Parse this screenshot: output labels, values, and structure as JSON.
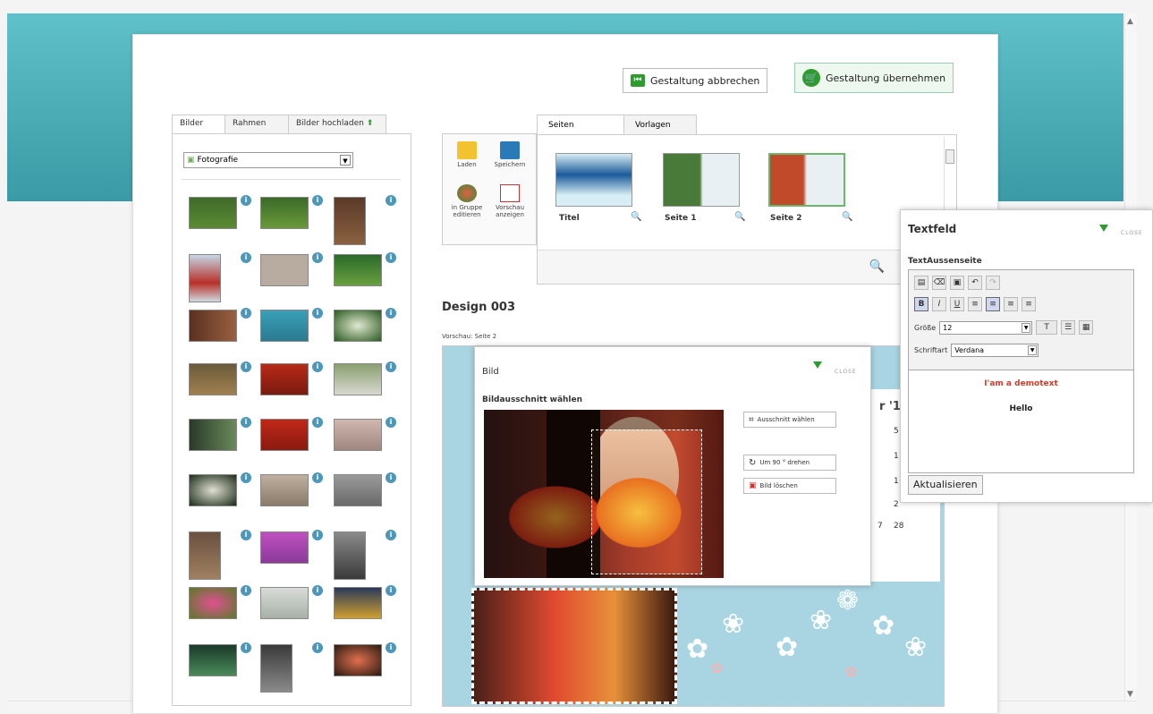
{
  "header": {
    "cancel_label": "Gestaltung abbrechen",
    "apply_label": "Gestaltung übernehmen"
  },
  "left_panel": {
    "tabs": [
      "Bilder",
      "Rahmen",
      "Bilder hochladen"
    ],
    "category_select": "Fotografie"
  },
  "toolbox": {
    "load": "Laden",
    "save": "Speichern",
    "group_edit": "in Gruppe editieren",
    "preview": "Vorschau anzeigen"
  },
  "pages": {
    "tabs": [
      "Seiten",
      "Vorlagen"
    ],
    "items": [
      "Titel",
      "Seite 1",
      "Seite 2"
    ]
  },
  "design": {
    "title": "Design 003",
    "preview_label": "Vorschau: Seite 2",
    "calendar_month_partial": "r '1",
    "calendar_numbers": [
      "5",
      "1",
      "1",
      "2",
      "28",
      "7"
    ]
  },
  "bild_dialog": {
    "title": "Bild",
    "close": "CLOSE",
    "subtitle": "Bildausschnitt wählen",
    "crop_btn": "Ausschnitt wählen",
    "rotate_btn": "Um 90 ° drehen",
    "delete_btn": "Bild löschen"
  },
  "textfeld_dialog": {
    "title": "Textfeld",
    "close": "CLOSE",
    "subtitle": "TextAussenseite",
    "size_label": "Größe",
    "size_value": "12",
    "font_label": "Schriftart",
    "font_value": "Verdana",
    "red_text": "I'am a demotext",
    "hello_text": "Hello",
    "update_btn": "Aktualisieren"
  },
  "colors": {
    "accent_teal": "#4fb3bd",
    "green": "#2e9b2e",
    "info_blue": "#4e97b8",
    "demotext_red": "#d43b2b"
  }
}
